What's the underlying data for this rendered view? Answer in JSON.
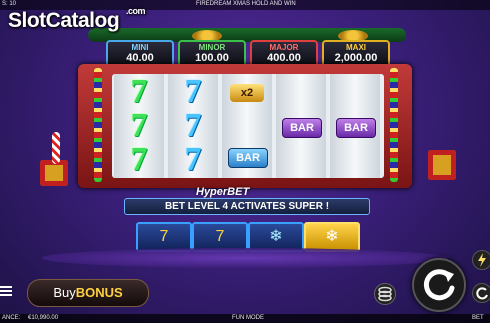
{
  "top_bar": {
    "left_text": "S: 10",
    "title": "FIREDREAM XMAS HOLD AND WIN"
  },
  "watermark": {
    "text": "SlotCatalog",
    "suffix": ".com"
  },
  "jackpots": [
    {
      "name": "MINI",
      "value": "40.00",
      "color": "#7fd0ff"
    },
    {
      "name": "MINOR",
      "value": "100.00",
      "color": "#7fe37f"
    },
    {
      "name": "MAJOR",
      "value": "400.00",
      "color": "#ff6b6b"
    },
    {
      "name": "MAXI",
      "value": "2,000.00",
      "color": "#ffd040"
    }
  ],
  "reels": {
    "multiplier": "x2",
    "bar_label": "BAR"
  },
  "hyper_bet": {
    "label": "HyperBET",
    "message": "BET LEVEL 4 ACTIVATES SUPER !"
  },
  "buy_bonus": {
    "buy": "Buy",
    "bonus": "BONUS"
  },
  "bottom_bar": {
    "balance_label": "ANCE:",
    "balance_value": "€10,990.00",
    "mode": "FUN MODE",
    "bet_label": "BET"
  }
}
